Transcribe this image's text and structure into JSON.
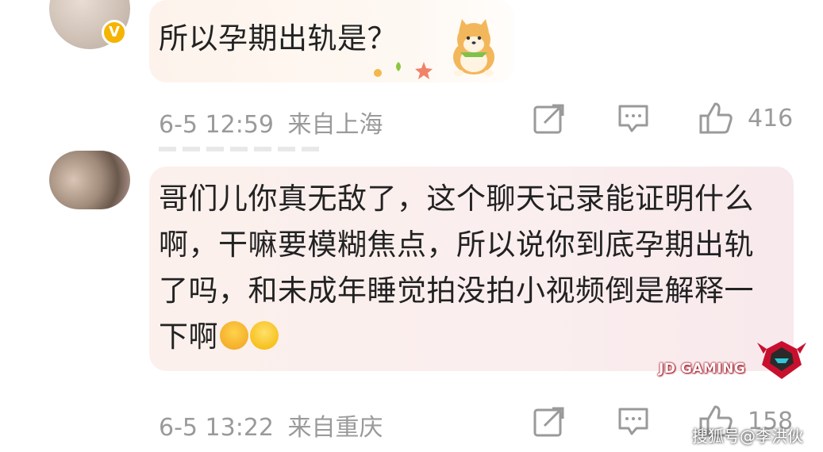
{
  "comments": [
    {
      "text": "所以孕期出轨是？",
      "date": "6-5 12:59",
      "location": "来自上海",
      "likes": "416",
      "verified_badge": "V"
    },
    {
      "text": "哥们儿你真无敌了，这个聊天记录能证明什么啊，干嘛要模糊焦点，所以说你到底孕期出轨了吗，和未成年睡觉拍没拍小视频倒是解释一下啊",
      "date": "6-5 13:22",
      "location": "来自重庆",
      "likes": "158"
    }
  ],
  "overlay": {
    "brand": "JD GAMING",
    "watermark": "搜狐号@李洪伙"
  },
  "icons": {
    "share": "share-icon",
    "comment": "comment-icon",
    "like": "thumbs-up-icon"
  },
  "colors": {
    "meta_text": "#9a9a9a",
    "bubble": "#fbeeee",
    "badge": "#f5b400"
  }
}
